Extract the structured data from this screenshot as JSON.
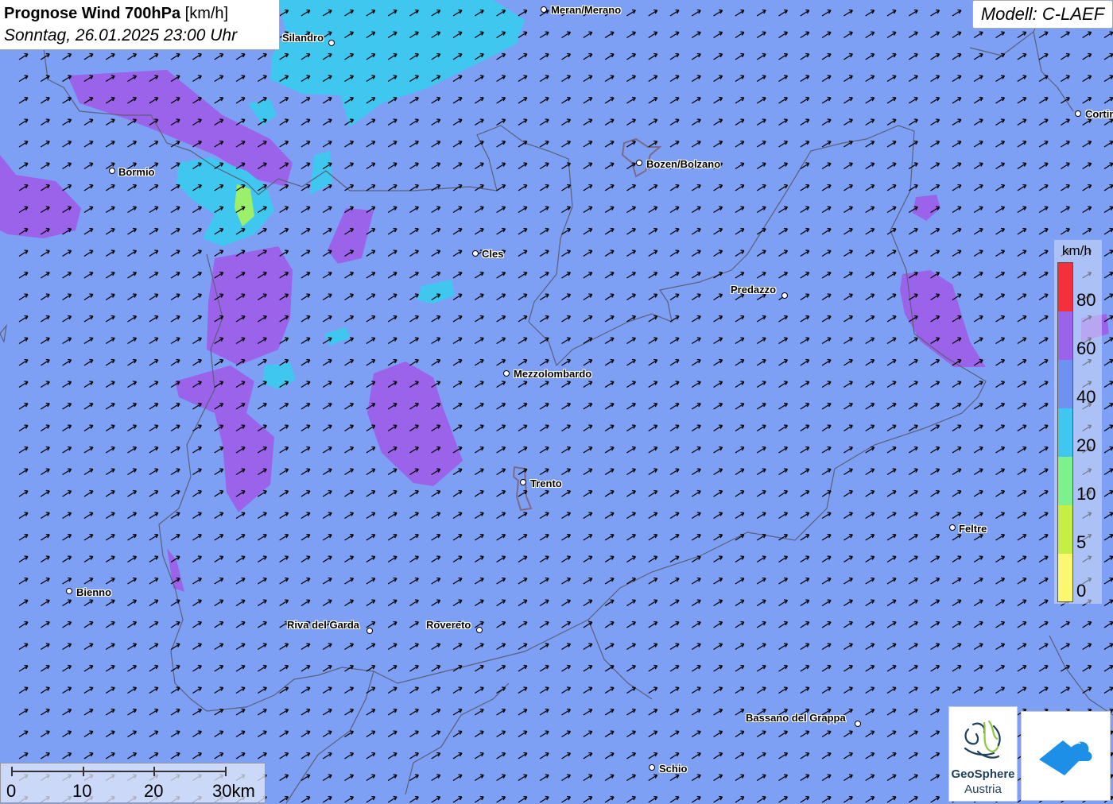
{
  "header": {
    "title_bold": "Prognose Wind 700hPa",
    "title_unit": "[km/h]",
    "datetime": "Sonntag, 26.01.2025 23:00 Uhr",
    "model": "Modell: C-LAEF"
  },
  "legend": {
    "unit": "km/h",
    "labels": [
      "80",
      "60",
      "40",
      "20",
      "10",
      "5",
      "0"
    ],
    "colors": [
      "#f5303a",
      "#9b63ea",
      "#6f92f0",
      "#3fc7f0",
      "#7ef08c",
      "#c6ef46",
      "#fbf76e"
    ]
  },
  "cities": [
    {
      "name": "Meran/Merano"
    },
    {
      "name": "Silandro"
    },
    {
      "name": "Bormio"
    },
    {
      "name": "Bozen/Bolzano"
    },
    {
      "name": "Cortina"
    },
    {
      "name": "Cles"
    },
    {
      "name": "Predazzo"
    },
    {
      "name": "Mezzolombardo"
    },
    {
      "name": "Trento"
    },
    {
      "name": "Feltre"
    },
    {
      "name": "Bienno"
    },
    {
      "name": "Riva del Garda"
    },
    {
      "name": "Rovereto"
    },
    {
      "name": "Bassano del Grappa"
    },
    {
      "name": "Schio"
    }
  ],
  "scale_bar": {
    "labels": [
      "0",
      "10",
      "20",
      "30km"
    ]
  },
  "logos": {
    "geosphere_name": "GeoSphere",
    "geosphere_sub": "Austria"
  },
  "colors": {
    "background_wind": "#7ea0f4",
    "high_wind": "#9b63ea",
    "low_wind": "#3fc7f0",
    "very_low_wind": "#9cef6a"
  }
}
